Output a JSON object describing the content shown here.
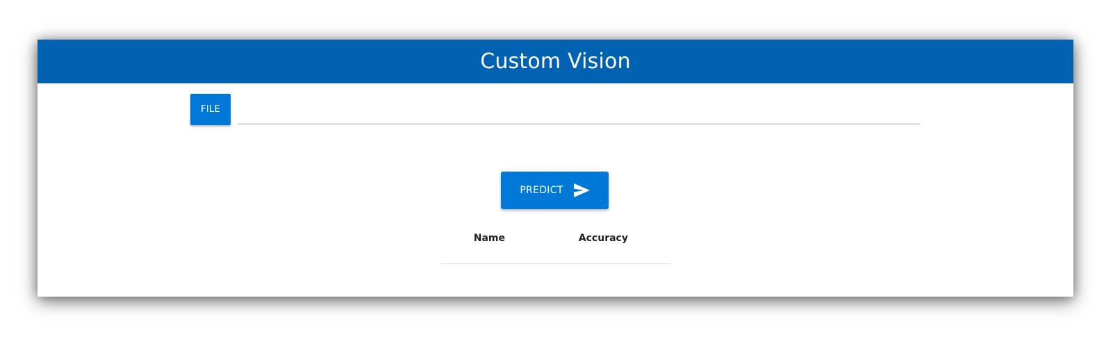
{
  "app": {
    "title": "Custom Vision"
  },
  "file_picker": {
    "button_label": "FILE",
    "value": "",
    "placeholder": ""
  },
  "predict": {
    "label": "PREDICT",
    "icon": "send-icon"
  },
  "results": {
    "columns": [
      "Name",
      "Accuracy"
    ],
    "rows": []
  },
  "colors": {
    "header_bg": "#0062b1",
    "accent": "#0078d7"
  }
}
